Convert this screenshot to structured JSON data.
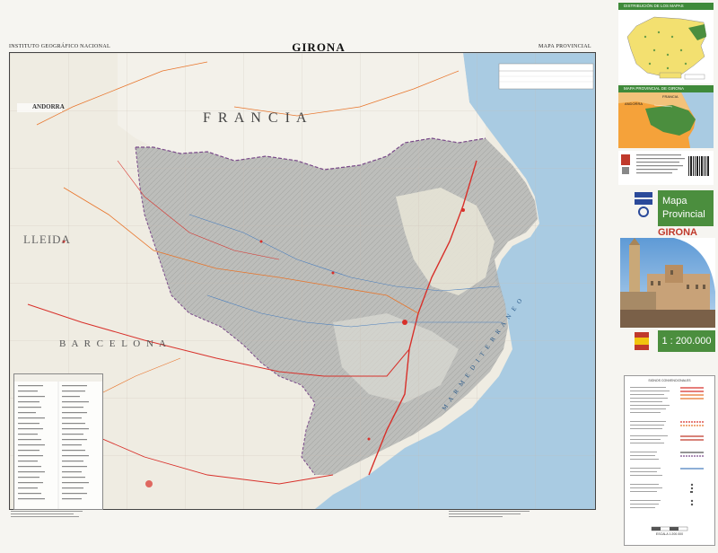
{
  "header": {
    "publisher": "INSTITUTO GEOGRÁFICO NACIONAL",
    "title": "GIRONA",
    "series": "MAPA PROVINCIAL"
  },
  "map": {
    "labels": {
      "france": "F R A N C I A",
      "andorra": "ANDORRA",
      "lleida": "LLEIDA",
      "barcelona": "B A R C E L O N A",
      "sea": "M A R   M E D I T E R R A N E O"
    }
  },
  "cover": {
    "distribution_title": "DISTRIBUCIÓN DE LOS MAPAS PROVINCIALES",
    "provincial_title": "MAPA PROVINCIAL DE GIRONA",
    "inset_france": "FRANCIA",
    "inset_andorra": "ANDORRA",
    "brand_line1": "Mapa",
    "brand_line2": "Provincial",
    "province_name": "GIRONA",
    "scale": "1 : 200.000",
    "legend_title": "SIGNOS CONVENCIONALES",
    "scale_label": "ESCALA 1:200.000"
  },
  "colors": {
    "sea": "#a9cbe2",
    "terrain": "#efece2",
    "relief": "#b7b9b8",
    "accent_green": "#4b8e3e",
    "inset_orange": "#f5a23a",
    "road_red": "#d8302a"
  }
}
